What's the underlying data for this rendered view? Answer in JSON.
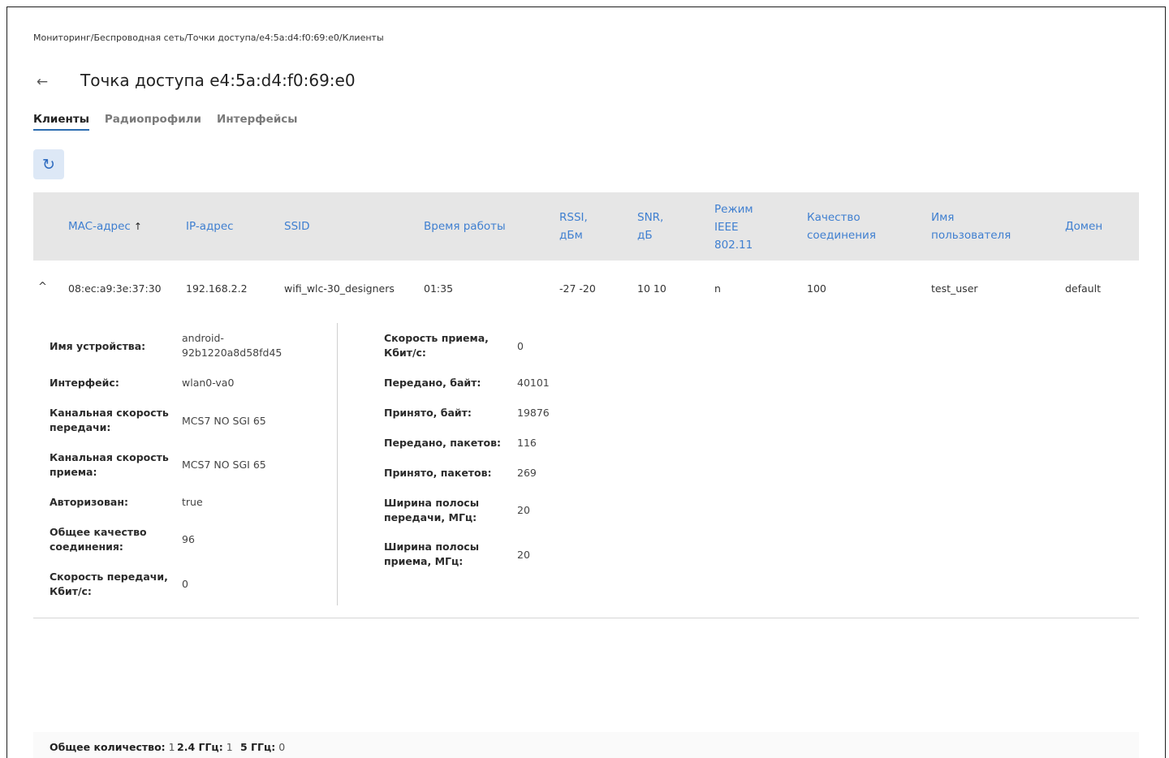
{
  "breadcrumb": "Мониторинг/Беспроводная сеть/Точки доступа/e4:5a:d4:f0:69:e0/Клиенты",
  "title": "Точка доступа e4:5a:d4:f0:69:e0",
  "back_icon": "←",
  "tabs": [
    {
      "label": "Клиенты",
      "active": true
    },
    {
      "label": "Радиопрофили",
      "active": false
    },
    {
      "label": "Интерфейсы",
      "active": false
    }
  ],
  "refresh_icon": "↻",
  "columns": {
    "mac": "MAC-адрес",
    "mac_sort": "↑",
    "ip": "IP-адрес",
    "ssid": "SSID",
    "uptime": "Время работы",
    "rssi_1": "RSSI,",
    "rssi_2": "дБм",
    "snr_1": "SNR,",
    "snr_2": "дБ",
    "mode_1": "Режим",
    "mode_2": "IEEE",
    "mode_3": "802.11",
    "quality_1": "Качество",
    "quality_2": "соединения",
    "user_1": "Имя",
    "user_2": "пользователя",
    "domain": "Домен"
  },
  "row": {
    "collapse_icon": "^",
    "mac": "08:ec:a9:3e:37:30",
    "ip": "192.168.2.2",
    "ssid": "wifi_wlc-30_designers",
    "uptime": "01:35",
    "rssi": "-27 -20",
    "snr": "10 10",
    "mode": "n",
    "quality": "100",
    "user": "test_user",
    "domain": "default"
  },
  "details": {
    "left": [
      {
        "label1": "Имя устройства:",
        "label2": "",
        "value1": "android-",
        "value2": "92b1220a8d58fd45"
      },
      {
        "label1": "Интерфейс:",
        "label2": "",
        "value1": "wlan0-va0",
        "value2": ""
      },
      {
        "label1": "Канальная скорость",
        "label2": "передачи:",
        "value1": "MCS7 NO SGI 65",
        "value2": ""
      },
      {
        "label1": "Канальная скорость",
        "label2": "приема:",
        "value1": "MCS7 NO SGI 65",
        "value2": ""
      },
      {
        "label1": "Авторизован:",
        "label2": "",
        "value1": "true",
        "value2": ""
      },
      {
        "label1": "Общее качество",
        "label2": "соединения:",
        "value1": "96",
        "value2": ""
      },
      {
        "label1": "Скорость передачи,",
        "label2": "Кбит/с:",
        "value1": "0",
        "value2": ""
      }
    ],
    "right": [
      {
        "label1": "Скорость приема,",
        "label2": "Кбит/с:",
        "value": "0"
      },
      {
        "label1": "Передано, байт:",
        "label2": "",
        "value": "40101"
      },
      {
        "label1": "Принято, байт:",
        "label2": "",
        "value": "19876"
      },
      {
        "label1": "Передано, пакетов:",
        "label2": "",
        "value": "116"
      },
      {
        "label1": "Принято, пакетов:",
        "label2": "",
        "value": "269"
      },
      {
        "label1": "Ширина полосы",
        "label2": "передачи, МГц:",
        "value": "20"
      },
      {
        "label1": "Ширина полосы",
        "label2": "приема, МГц:",
        "value": "20"
      }
    ]
  },
  "footer": {
    "total_label": "Общее количество:",
    "total_value": "1",
    "g24_label": "2.4 ГГц:",
    "g24_value": "1",
    "g5_label": "5 ГГц:",
    "g5_value": "0"
  }
}
